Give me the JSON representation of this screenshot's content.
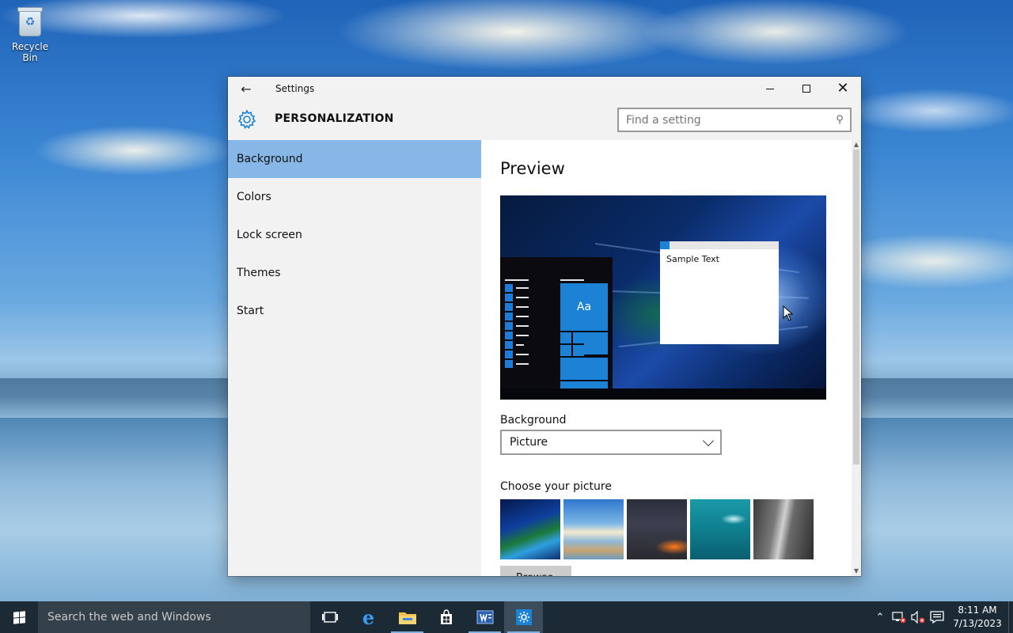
{
  "desktop": {
    "recycle_bin_label": "Recycle Bin"
  },
  "window": {
    "title": "Settings",
    "section_title": "PERSONALIZATION",
    "search_placeholder": "Find a setting"
  },
  "nav": {
    "items": [
      {
        "label": "Background",
        "active": true
      },
      {
        "label": "Colors"
      },
      {
        "label": "Lock screen"
      },
      {
        "label": "Themes"
      },
      {
        "label": "Start"
      }
    ]
  },
  "content": {
    "preview_heading": "Preview",
    "preview_sample_text": "Sample Text",
    "preview_tile_text": "Aa",
    "background_label": "Background",
    "background_value": "Picture",
    "choose_picture_label": "Choose your picture",
    "browse_label": "Browse"
  },
  "taskbar": {
    "search_placeholder": "Search the web and Windows",
    "time": "8:11 AM",
    "date": "7/13/2023",
    "icons": [
      "task-view-icon",
      "edge-icon",
      "file-explorer-icon",
      "store-icon",
      "wordpad-icon",
      "settings-icon"
    ]
  },
  "colors": {
    "accent": "#1b82d6",
    "nav_active": "#86b7e6",
    "taskbar": "#1c2a36"
  }
}
